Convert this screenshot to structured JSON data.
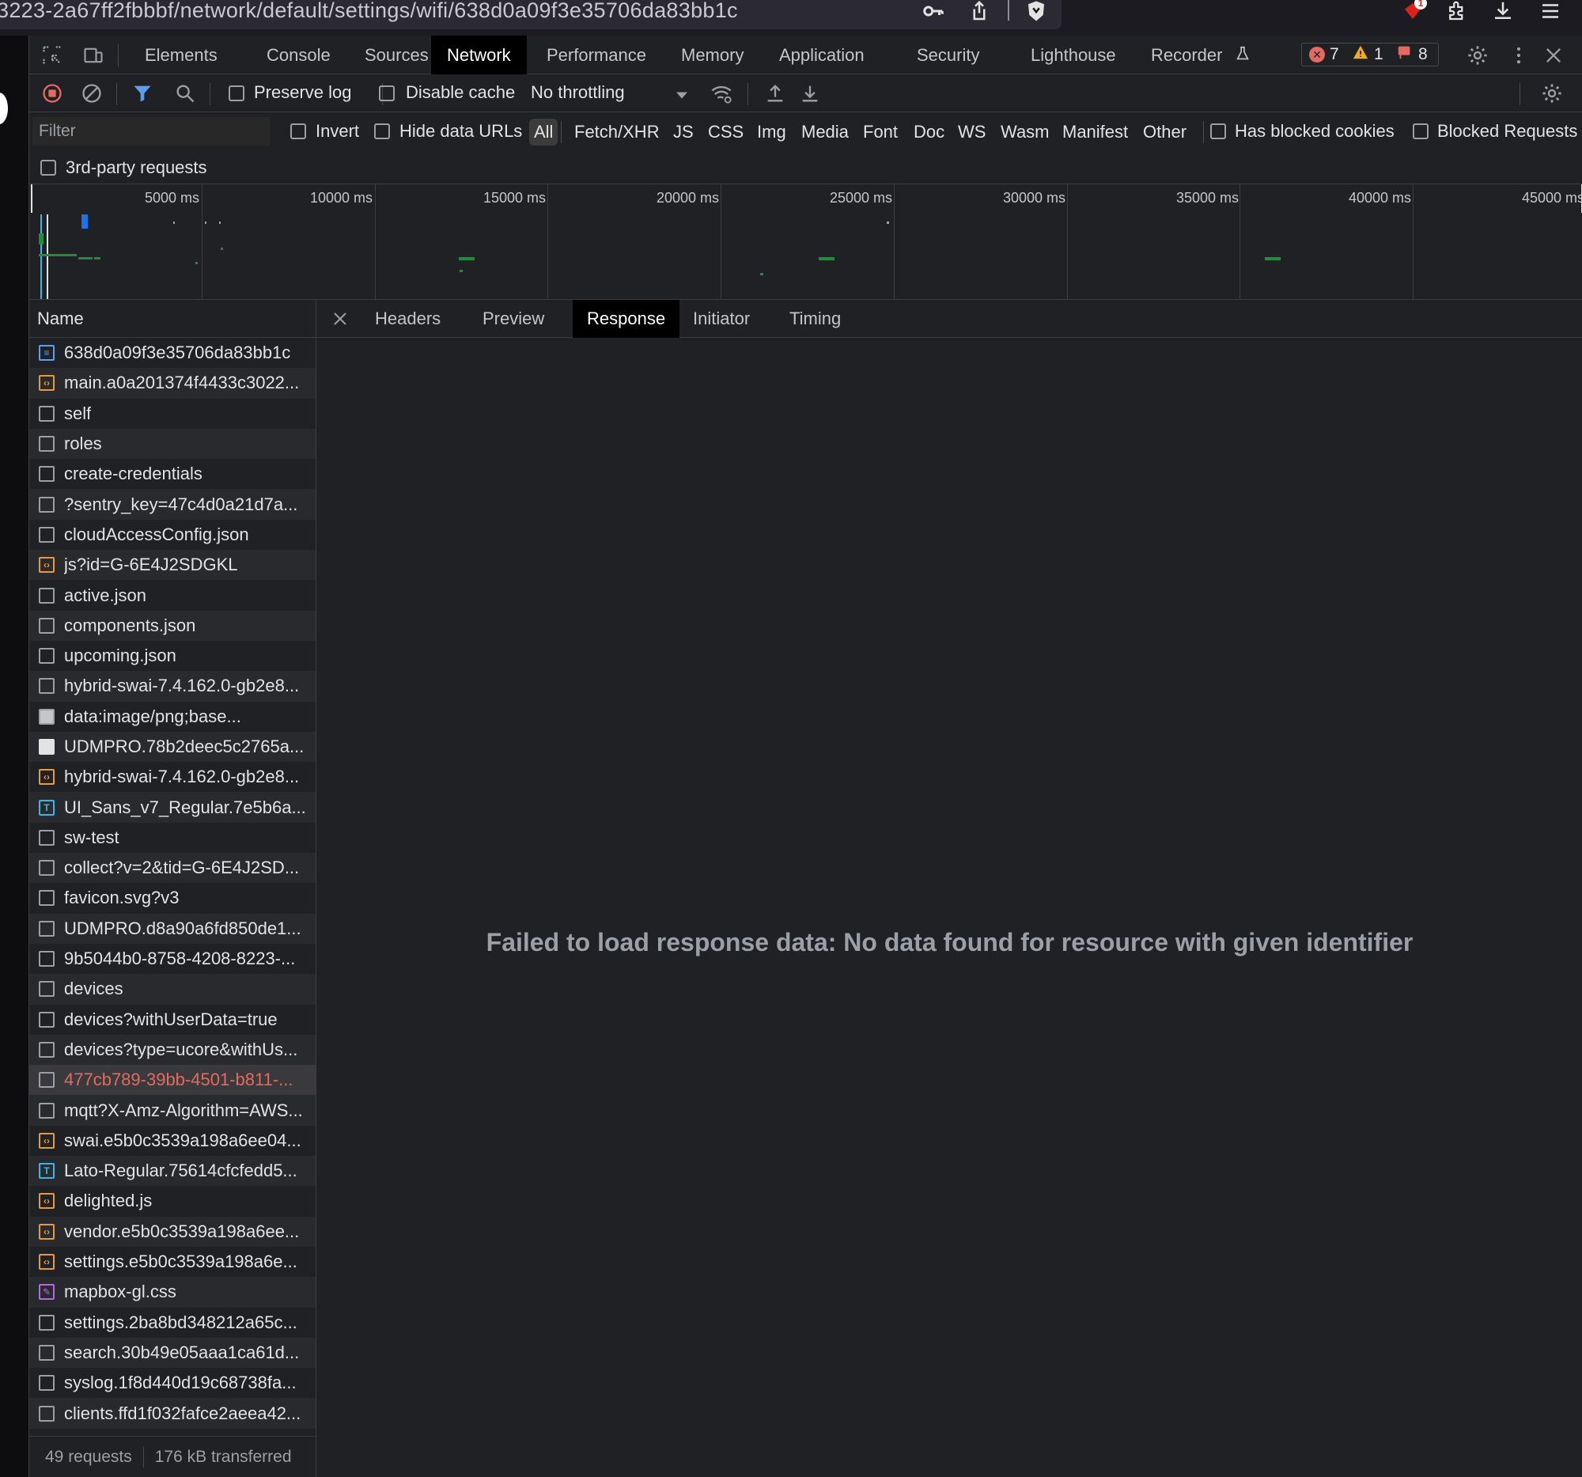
{
  "browser": {
    "url": "3223-2a67ff2fbbbf/network/default/settings/wifi/638d0a09f3e35706da83bb1c",
    "notification_count": "1"
  },
  "devtools": {
    "tabs": [
      "Elements",
      "Console",
      "Sources",
      "Network",
      "Performance",
      "Memory",
      "Application",
      "Security",
      "Lighthouse",
      "Recorder"
    ],
    "active_tab": "Network",
    "counts": {
      "errors": "7",
      "warnings": "1",
      "issues": "8"
    }
  },
  "toolbar": {
    "preserve_log": "Preserve log",
    "disable_cache": "Disable cache",
    "throttling": "No throttling"
  },
  "filter": {
    "placeholder": "Filter",
    "invert": "Invert",
    "hide_data_urls": "Hide data URLs",
    "types": [
      "All",
      "Fetch/XHR",
      "JS",
      "CSS",
      "Img",
      "Media",
      "Font",
      "Doc",
      "WS",
      "Wasm",
      "Manifest",
      "Other"
    ],
    "active_type": "All",
    "has_blocked_cookies": "Has blocked cookies",
    "blocked_requests": "Blocked Requests",
    "third_party": "3rd-party requests"
  },
  "overview": {
    "labels": [
      "5000 ms",
      "10000 ms",
      "15000 ms",
      "20000 ms",
      "25000 ms",
      "30000 ms",
      "35000 ms",
      "40000 ms",
      "45000 ms"
    ]
  },
  "requests": {
    "header": "Name",
    "items": [
      {
        "name": "638d0a09f3e35706da83bb1c",
        "type": "doc"
      },
      {
        "name": "main.a0a201374f4433c3022...",
        "type": "script"
      },
      {
        "name": "self",
        "type": "other"
      },
      {
        "name": "roles",
        "type": "other"
      },
      {
        "name": "create-credentials",
        "type": "other"
      },
      {
        "name": "?sentry_key=47c4d0a21d7a...",
        "type": "other"
      },
      {
        "name": "cloudAccessConfig.json",
        "type": "other"
      },
      {
        "name": "js?id=G-6E4J2SDGKL",
        "type": "script"
      },
      {
        "name": "active.json",
        "type": "other"
      },
      {
        "name": "components.json",
        "type": "other"
      },
      {
        "name": "upcoming.json",
        "type": "other"
      },
      {
        "name": "hybrid-swai-7.4.162.0-gb2e8...",
        "type": "other"
      },
      {
        "name": "data:image/png;base...",
        "type": "img"
      },
      {
        "name": "UDMPRO.78b2deec5c2765a...",
        "type": "imgw"
      },
      {
        "name": "hybrid-swai-7.4.162.0-gb2e8...",
        "type": "script"
      },
      {
        "name": "UI_Sans_v7_Regular.7e5b6a...",
        "type": "font"
      },
      {
        "name": "sw-test",
        "type": "other"
      },
      {
        "name": "collect?v=2&tid=G-6E4J2SD...",
        "type": "other"
      },
      {
        "name": "favicon.svg?v3",
        "type": "other"
      },
      {
        "name": "UDMPRO.d8a90a6fd850de1...",
        "type": "other"
      },
      {
        "name": "9b5044b0-8758-4208-8223-...",
        "type": "other"
      },
      {
        "name": "devices",
        "type": "other"
      },
      {
        "name": "devices?withUserData=true",
        "type": "other"
      },
      {
        "name": "devices?type=ucore&withUs...",
        "type": "other"
      },
      {
        "name": "477cb789-39bb-4501-b811-...",
        "type": "other",
        "error": true
      },
      {
        "name": "mqtt?X-Amz-Algorithm=AWS...",
        "type": "other"
      },
      {
        "name": "swai.e5b0c3539a198a6ee04...",
        "type": "script"
      },
      {
        "name": "Lato-Regular.75614cfcfedd5...",
        "type": "font"
      },
      {
        "name": "delighted.js",
        "type": "script"
      },
      {
        "name": "vendor.e5b0c3539a198a6ee...",
        "type": "script"
      },
      {
        "name": "settings.e5b0c3539a198a6e...",
        "type": "script"
      },
      {
        "name": "mapbox-gl.css",
        "type": "css"
      },
      {
        "name": "settings.2ba8bd348212a65c...",
        "type": "other"
      },
      {
        "name": "search.30b49e05aaa1ca61d...",
        "type": "other"
      },
      {
        "name": "syslog.1f8d440d19c68738fa...",
        "type": "other"
      },
      {
        "name": "clients.ffd1f032fafce2aeea42...",
        "type": "other"
      }
    ],
    "summary_requests": "49 requests",
    "summary_transferred": "176 kB transferred"
  },
  "details": {
    "tabs": [
      "Headers",
      "Preview",
      "Response",
      "Initiator",
      "Timing"
    ],
    "active_tab": "Response",
    "message": "Failed to load response data: No data found for resource with given identifier"
  }
}
